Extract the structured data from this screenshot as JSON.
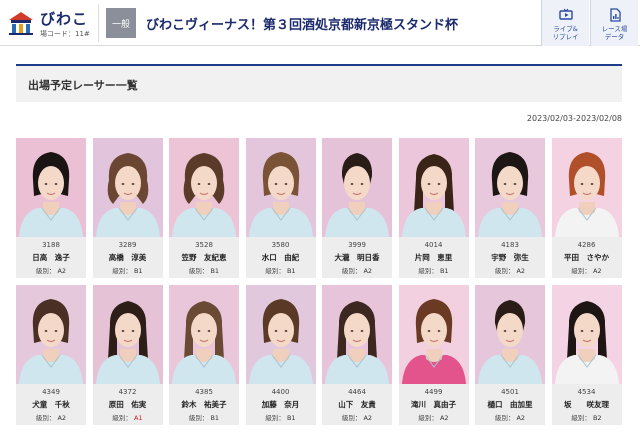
{
  "header": {
    "venue_name": "びわこ",
    "venue_code": "場コード：11#",
    "grade": "一般",
    "race_title": "びわこヴィーナス！第３回酒処京都新京極スタンド杯",
    "replay_label": "ライブ&\nリプレイ",
    "data_label": "レース場\nデータ"
  },
  "section": {
    "title": "出場予定レーサー一覧",
    "date_range": "2023/02/03-2023/02/08",
    "class_prefix": "級別："
  },
  "racers": [
    {
      "number": "3188",
      "name": "日高　逸子",
      "class": "A2",
      "bg": "#ecc0d4",
      "hair": "#1a1412",
      "hair_style": "bob",
      "suit": "#cfe6ee"
    },
    {
      "number": "3289",
      "name": "高橋　淳美",
      "class": "B1",
      "bg": "#e2c4dc",
      "hair": "#6b4632",
      "hair_style": "wavy",
      "suit": "#cfe6ee"
    },
    {
      "number": "3528",
      "name": "笠野　友紀恵",
      "class": "B1",
      "bg": "#ecc4d6",
      "hair": "#5a3a28",
      "hair_style": "wavy",
      "suit": "#cfe6ee"
    },
    {
      "number": "3580",
      "name": "水口　由紀",
      "class": "B1",
      "bg": "#e4c6dc",
      "hair": "#7a5236",
      "hair_style": "bob",
      "suit": "#cfe6ee"
    },
    {
      "number": "3999",
      "name": "大瀧　明日香",
      "class": "A2",
      "bg": "#e6c2d8",
      "hair": "#2a1c16",
      "hair_style": "tied",
      "suit": "#cfe6ee"
    },
    {
      "number": "4014",
      "name": "片岡　恵里",
      "class": "B1",
      "bg": "#ecc6da",
      "hair": "#3a2418",
      "hair_style": "long",
      "suit": "#cfe6ee"
    },
    {
      "number": "4183",
      "name": "宇野　弥生",
      "class": "A2",
      "bg": "#e8c8dc",
      "hair": "#1e1614",
      "hair_style": "bob",
      "suit": "#cfe6ee"
    },
    {
      "number": "4286",
      "name": "平田　さやか",
      "class": "A2",
      "bg": "#f4d2e2",
      "hair": "#b0502a",
      "hair_style": "bob",
      "suit": "#f3f3f3"
    },
    {
      "number": "4349",
      "name": "犬童　千秋",
      "class": "A2",
      "bg": "#e6c8dc",
      "hair": "#4a3024",
      "hair_style": "bob",
      "suit": "#cfe6ee"
    },
    {
      "number": "4372",
      "name": "原田　佑実",
      "class": "A1",
      "bg": "#e6c2d6",
      "hair": "#2e1e18",
      "hair_style": "long",
      "suit": "#cfe6ee"
    },
    {
      "number": "4385",
      "name": "鈴木　祐美子",
      "class": "B1",
      "bg": "#eac6da",
      "hair": "#6a4a34",
      "hair_style": "long",
      "suit": "#cfe6ee"
    },
    {
      "number": "4400",
      "name": "加藤　奈月",
      "class": "B1",
      "bg": "#e2c8dc",
      "hair": "#5a3a26",
      "hair_style": "bob",
      "suit": "#cfe6ee"
    },
    {
      "number": "4464",
      "name": "山下　友貴",
      "class": "A2",
      "bg": "#e8c4da",
      "hair": "#3c2820",
      "hair_style": "long",
      "suit": "#cfe6ee"
    },
    {
      "number": "4499",
      "name": "滝川　真由子",
      "class": "A2",
      "bg": "#f2d0e0",
      "hair": "#6a3a24",
      "hair_style": "bob",
      "suit": "#e4548c"
    },
    {
      "number": "4501",
      "name": "樋口　由加里",
      "class": "A2",
      "bg": "#e6c6da",
      "hair": "#2a1c16",
      "hair_style": "tied",
      "suit": "#cfe6ee"
    },
    {
      "number": "4534",
      "name": "坂　　咲友理",
      "class": "B2",
      "bg": "#f4d4e4",
      "hair": "#1e1614",
      "hair_style": "long",
      "suit": "#f3f3f3"
    }
  ]
}
